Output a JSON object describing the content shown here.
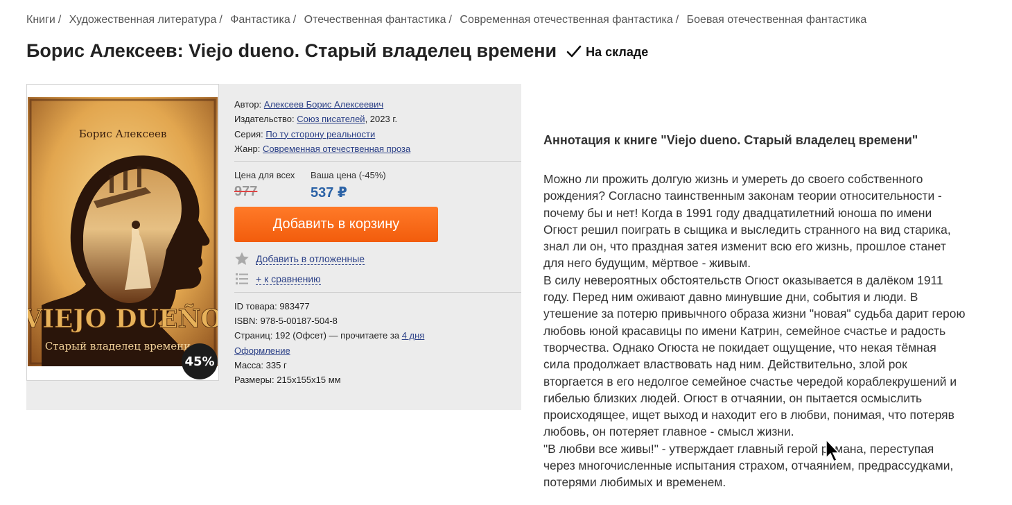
{
  "breadcrumb": [
    {
      "label": "Книги"
    },
    {
      "label": "Художественная литература"
    },
    {
      "label": "Фантастика"
    },
    {
      "label": "Отечественная фантастика"
    },
    {
      "label": "Современная отечественная фантастика"
    },
    {
      "label": "Боевая отечественная фантастика"
    }
  ],
  "product": {
    "title": "Борис Алексеев: Viejo dueno. Старый владелец времени",
    "stock_status": "На складе",
    "discount_badge": "45%",
    "cover": {
      "author": "Борис Алексеев",
      "title": "VIEJO DUEÑO",
      "subtitle": "Старый владелец времени"
    },
    "meta": {
      "author_label": "Автор:",
      "author": "Алексеев Борис Алексеевич",
      "publisher_label": "Издательство:",
      "publisher": "Союз писателей",
      "year": ", 2023 г.",
      "series_label": "Серия:",
      "series": "По ту сторону реальности",
      "genre_label": "Жанр:",
      "genre": "Современная отечественная проза"
    },
    "price": {
      "regular_label": "Цена для всех",
      "regular": "977",
      "yours_label": "Ваша цена (-45%)",
      "yours": "537 ₽"
    },
    "actions": {
      "add_to_cart": "Добавить в корзину",
      "wishlist": "Добавить в отложенные",
      "compare": "+ к сравнению"
    },
    "details": {
      "id": "ID товара: 983477",
      "isbn": "ISBN: 978-5-00187-504-8",
      "pages": "Страниц: 192 (Офсет) — прочитаете за ",
      "read_time": "4 дня",
      "design": "Оформление",
      "weight": "Масса: 335 г",
      "size": "Размеры: 215x155x15 мм"
    }
  },
  "annotation": {
    "title": "Аннотация к книге \"Viejo dueno. Старый владелец времени\"",
    "text": "Можно ли прожить долгую жизнь и умереть до своего собственного\nрождения? Согласно таинственным законам теории относительности -\nпочему бы и нет! Когда в 1991 году двадцатилетний юноша по имени\nОгюст решил поиграть в сыщика и выследить странного на вид старика,\nзнал ли он, что праздная затея изменит всю его жизнь, прошлое станет\nдля него будущим, мёртвое - живым.\nВ силу невероятных обстоятельств Огюст оказывается в далёком 1911\nгоду. Перед ним оживают давно минувшие дни, события и люди. В\nутешение за потерю привычного образа жизни \"новая\" судьба дарит герою\nлюбовь юной красавицы по имени Катрин, семейное счастье и радость\nтворчества. Однако Огюста не покидает ощущение, что некая тёмная\nсила продолжает властвовать над ним. Действительно, злой рок\nвторгается в его недолгое семейное счастье чередой кораблекрушений и\nгибелью близких людей. Огюст в отчаянии, он пытается осмыслить\nпроисходящее, ищет выход и находит его в любви, понимая, что потеряв\nлюбовь, он потеряет главное - смысл жизни.\n\"В любви все живы!\" - утверждает главный герой романа, переступая\nчерез многочисленные испытания страхом, отчаянием, предрассудками,\nпотерями любимых и временем."
  },
  "colors": {
    "accent_orange": "#f25c0c",
    "price_blue": "#2b62a6",
    "link_blue": "#2a3f86",
    "card_gray": "#ececec"
  }
}
